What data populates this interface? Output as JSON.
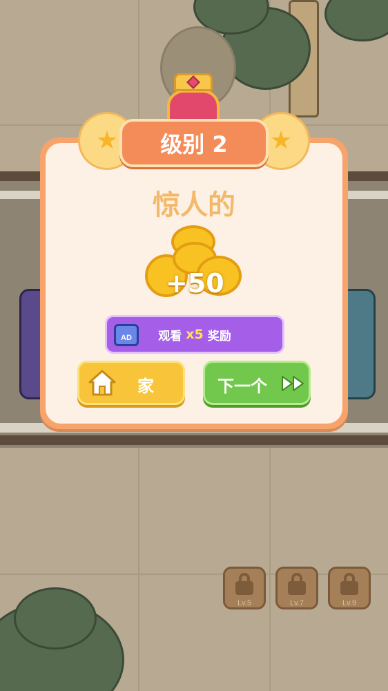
{
  "dialog": {
    "level_title": "级别 2",
    "headline": "惊人的",
    "reward_amount": "+50",
    "ad_button": {
      "badge": "AD",
      "watch_label": "观看",
      "multiplier": "x5",
      "reward_label": "奖励"
    },
    "home_button_label": "家",
    "next_button_label": "下一个"
  },
  "locked_levels": [
    {
      "label": "Lv.5"
    },
    {
      "label": "Lv.7"
    },
    {
      "label": "Lv.9"
    }
  ],
  "colors": {
    "panel_border": "#f7a36c",
    "panel_fill": "#fdf0e4",
    "title_banner": "#f48c5a",
    "headline_text": "#f2b96a",
    "ad_button": "#a45ee8",
    "home_button": "#f8c43a",
    "next_button": "#72c84c"
  },
  "icons": [
    "crown-icon",
    "star-icon",
    "coin-stack-icon",
    "ad-video-icon",
    "home-icon",
    "fast-forward-icon",
    "lock-icon"
  ]
}
